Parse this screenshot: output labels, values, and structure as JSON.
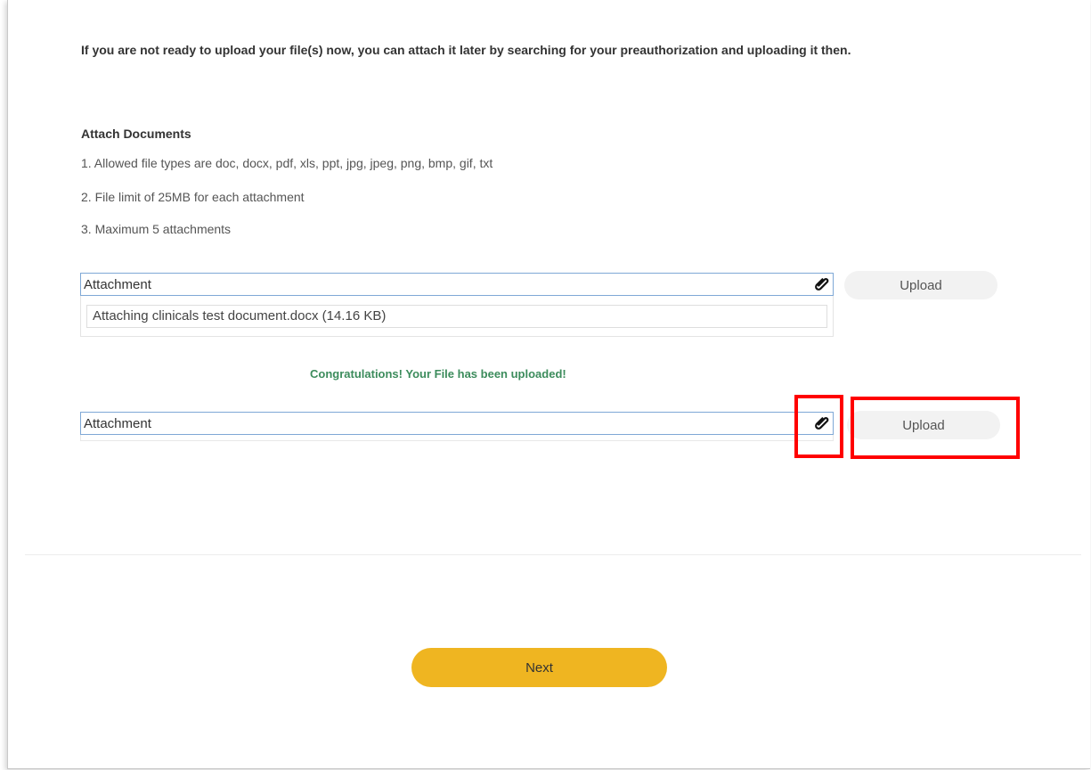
{
  "intro": {
    "text": "If you are not ready to upload your file(s) now, you can attach it later by searching for your preauthorization and uploading it then."
  },
  "attach_documents": {
    "heading": "Attach Documents",
    "rules": [
      "1. Allowed file types are doc, docx, pdf, xls, ppt, jpg, jpeg, png, bmp, gif, txt",
      "2. File limit of 25MB for each attachment",
      "3. Maximum 5 attachments"
    ]
  },
  "attachments": [
    {
      "label": "Attachment",
      "icon": "paperclip-icon",
      "upload_label": "Upload",
      "file": "Attaching clinicals test document.docx (14.16 KB)"
    },
    {
      "label": "Attachment",
      "icon": "paperclip-icon",
      "upload_label": "Upload"
    }
  ],
  "success_message": "Congratulations! Your File has been uploaded!",
  "next_label": "Next",
  "colors": {
    "success": "#3c8c5c",
    "next_button": "#efb521",
    "highlight": "#ff0000",
    "field_border": "#7fa8d6"
  }
}
